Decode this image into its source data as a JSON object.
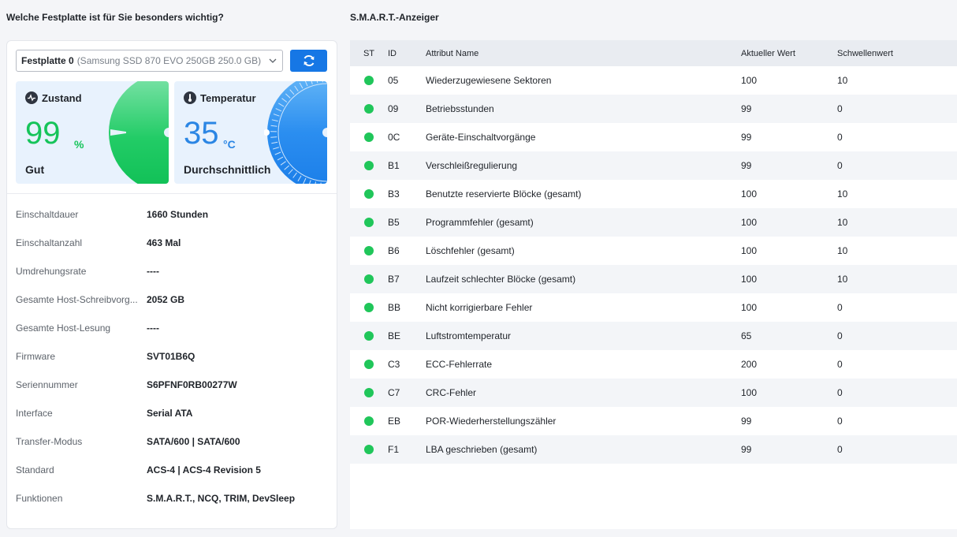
{
  "left": {
    "title": "Welche Festplatte ist für Sie besonders wichtig?",
    "disk": {
      "name": "Festplatte 0",
      "model": "(Samsung SSD 870 EVO 250GB 250.0 GB)"
    },
    "health": {
      "label": "Zustand",
      "value": "99",
      "unit": "%",
      "status": "Gut",
      "level": 99,
      "color": "#16c45a"
    },
    "temperature": {
      "label": "Temperatur",
      "value": "35",
      "unit": "°C",
      "status": "Durchschnittlich",
      "color": "#2b86e4"
    },
    "info": [
      {
        "key": "Einschaltdauer",
        "value": "1660 Stunden"
      },
      {
        "key": "Einschaltanzahl",
        "value": "463 Mal"
      },
      {
        "key": "Umdrehungsrate",
        "value": "----"
      },
      {
        "key": "Gesamte Host-Schreibvorg...",
        "value": "2052 GB"
      },
      {
        "key": "Gesamte Host-Lesung",
        "value": "----"
      },
      {
        "key": "Firmware",
        "value": "SVT01B6Q"
      },
      {
        "key": "Seriennummer",
        "value": "S6PFNF0RB00277W"
      },
      {
        "key": "Interface",
        "value": "Serial ATA"
      },
      {
        "key": "Transfer-Modus",
        "value": "SATA/600 | SATA/600"
      },
      {
        "key": "Standard",
        "value": "ACS-4 | ACS-4 Revision 5"
      },
      {
        "key": "Funktionen",
        "value": "S.M.A.R.T., NCQ, TRIM, DevSleep"
      }
    ]
  },
  "smart": {
    "title": "S.M.A.R.T.-Anzeiger",
    "headers": {
      "st": "ST",
      "id": "ID",
      "name": "Attribut Name",
      "current": "Aktueller Wert",
      "threshold": "Schwellenwert"
    },
    "rows": [
      {
        "id": "05",
        "name": "Wiederzugewiesene Sektoren",
        "current": "100",
        "threshold": "10"
      },
      {
        "id": "09",
        "name": "Betriebsstunden",
        "current": "99",
        "threshold": "0"
      },
      {
        "id": "0C",
        "name": "Geräte-Einschaltvorgänge",
        "current": "99",
        "threshold": "0"
      },
      {
        "id": "B1",
        "name": "Verschleißregulierung",
        "current": "99",
        "threshold": "0"
      },
      {
        "id": "B3",
        "name": "Benutzte reservierte Blöcke (gesamt)",
        "current": "100",
        "threshold": "10"
      },
      {
        "id": "B5",
        "name": "Programmfehler (gesamt)",
        "current": "100",
        "threshold": "10"
      },
      {
        "id": "B6",
        "name": "Löschfehler (gesamt)",
        "current": "100",
        "threshold": "10"
      },
      {
        "id": "B7",
        "name": "Laufzeit schlechter Blöcke (gesamt)",
        "current": "100",
        "threshold": "10"
      },
      {
        "id": "BB",
        "name": "Nicht korrigierbare Fehler",
        "current": "100",
        "threshold": "0"
      },
      {
        "id": "BE",
        "name": "Luftstromtemperatur",
        "current": "65",
        "threshold": "0"
      },
      {
        "id": "C3",
        "name": "ECC-Fehlerrate",
        "current": "200",
        "threshold": "0"
      },
      {
        "id": "C7",
        "name": "CRC-Fehler",
        "current": "100",
        "threshold": "0"
      },
      {
        "id": "EB",
        "name": "POR-Wiederherstellungszähler",
        "current": "99",
        "threshold": "0"
      },
      {
        "id": "F1",
        "name": "LBA geschrieben (gesamt)",
        "current": "99",
        "threshold": "0"
      }
    ],
    "status_color": "#20c65a"
  },
  "accent": "#1677e5"
}
